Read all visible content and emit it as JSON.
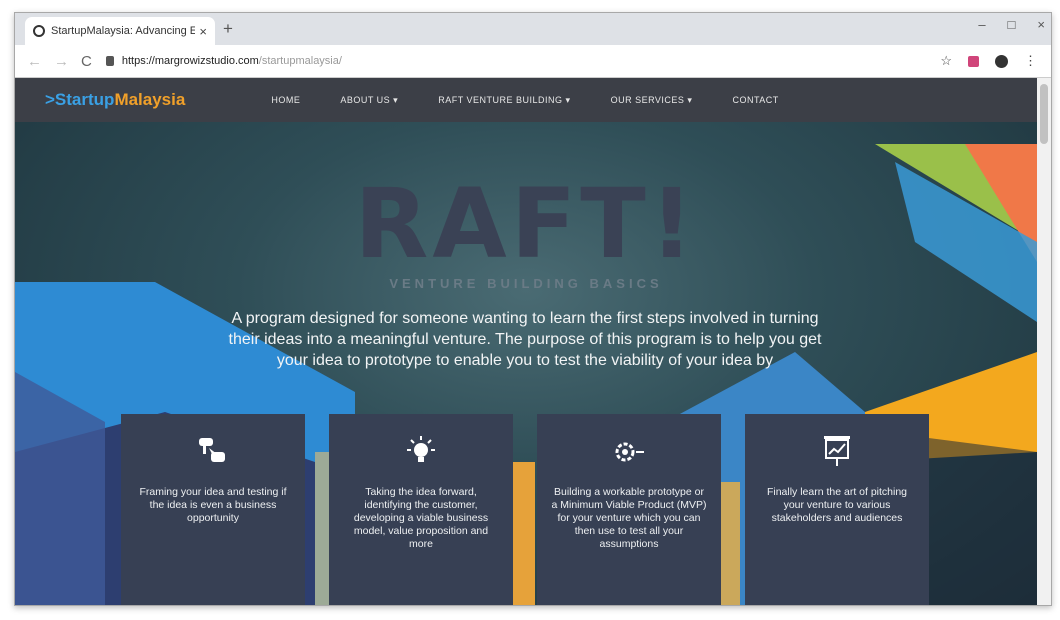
{
  "browser": {
    "tab_title": "StartupMalaysia: Advancing En",
    "tab_close": "×",
    "new_tab": "+",
    "window_controls": [
      "–",
      "□",
      "×"
    ],
    "nav": {
      "back": "←",
      "forward": "→",
      "reload": "C"
    },
    "url_host": "https://margrowizstudio.com",
    "url_path": "/startupmalaysia/",
    "toolbar_icons": [
      "star-icon",
      "extension-icon",
      "profile-icon",
      "menu-icon"
    ],
    "star": "☆",
    "menu": "⋮"
  },
  "site": {
    "logo_prefix": ">Startup",
    "logo_suffix": "Malaysia",
    "menu": [
      "HOME",
      "ABOUT US ▾",
      "RAFT VENTURE BUILDING ▾",
      "OUR SERVICES ▾",
      "CONTACT"
    ]
  },
  "hero": {
    "title": "RAFT!",
    "subtitle": "VENTURE BUILDING BASICS",
    "description": "A program designed for someone wanting to learn the first steps involved in turning their ideas into a meaningful venture. The purpose of this program is to help you get your idea to prototype to enable you to test the viability of your idea by"
  },
  "cards": [
    {
      "icon": "hand-pointer-icon",
      "text": "Framing your idea and testing if the idea is even a business opportunity"
    },
    {
      "icon": "lightbulb-icon",
      "text": "Taking the idea forward, identifying the customer, developing a viable business model, value proposition and more"
    },
    {
      "icon": "gear-arrow-icon",
      "text": "Building a workable prototype or a Minimum Viable Product (MVP) for your venture which you can then use to test all your assumptions"
    },
    {
      "icon": "presentation-icon",
      "text": "Finally learn the art of pitching your venture to various stakeholders and audiences"
    }
  ],
  "colors": {
    "logo_blue": "#3aa0e4",
    "logo_orange": "#f0a02a",
    "header_bg": "#3c3f47",
    "card_bg": "#374054",
    "title_color": "#3a4255"
  }
}
